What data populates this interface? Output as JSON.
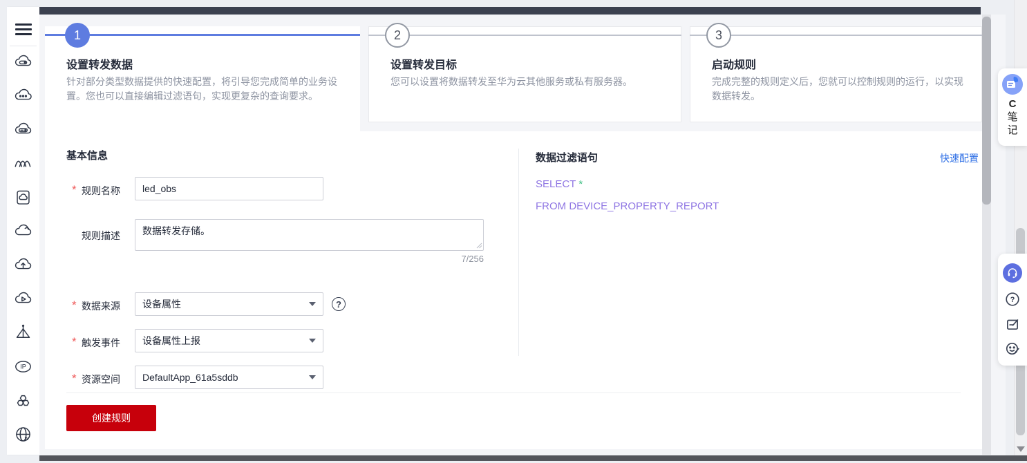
{
  "sidebar": {
    "icons": [
      "menu-icon",
      "cloud-device-icon",
      "cloud-ellipsis-icon",
      "cloud-server-icon",
      "waves-icon",
      "device-panel-icon",
      "cloud-icon",
      "cloud-upload-icon",
      "cloud-play-icon",
      "pyramid-icon",
      "ip-icon",
      "hexagon-cluster-icon",
      "globe-icon"
    ]
  },
  "stepper": {
    "steps": [
      {
        "number": "1",
        "title": "设置转发数据",
        "desc": "针对部分类型数据提供的快速配置，将引导您完成简单的业务设置。您也可以直接编辑过滤语句，实现更复杂的查询要求。",
        "state": "active"
      },
      {
        "number": "2",
        "title": "设置转发目标",
        "desc": "您可以设置将数据转发至华为云其他服务或私有服务器。",
        "state": "pending"
      },
      {
        "number": "3",
        "title": "启动规则",
        "desc": "完成完整的规则定义后，您就可以控制规则的运行，以实现数据转发。",
        "state": "pending"
      }
    ]
  },
  "form": {
    "section_title": "基本信息",
    "required_marker": "*",
    "fields": [
      {
        "label": "规则名称",
        "required": true,
        "type": "input",
        "value": "led_obs"
      },
      {
        "label": "规则描述",
        "required": false,
        "type": "textarea",
        "value": "数据转发存储。",
        "counter": "7/256"
      },
      {
        "label": "数据来源",
        "required": true,
        "type": "select",
        "value": "设备属性",
        "help": true
      },
      {
        "label": "触发事件",
        "required": true,
        "type": "select",
        "value": "设备属性上报"
      },
      {
        "label": "资源空间",
        "required": true,
        "type": "select",
        "value": "DefaultApp_61a5sddb"
      }
    ],
    "help_glyph": "?",
    "submit_label": "创建规则"
  },
  "sql_panel": {
    "title": "数据过滤语句",
    "quick_link": "快速配置",
    "line1_keyword": "SELECT",
    "line1_star": "*",
    "line2": "FROM DEVICE_PROPERTY_REPORT"
  },
  "floating_note": {
    "chars": [
      "C",
      "笔",
      "记"
    ]
  },
  "help_toolbar": {
    "icons": [
      "headset-icon",
      "question-icon",
      "feedback-form-icon",
      "smiley-feedback-icon"
    ]
  },
  "colors": {
    "accent_blue": "#5e7ce0",
    "link_blue": "#2b6de5",
    "button_red": "#c7000b",
    "sql_purple": "#8f76e3",
    "sql_star_green": "#3fbf84",
    "required_red": "#ef5a5a",
    "topbar_dark": "#3c4150"
  }
}
